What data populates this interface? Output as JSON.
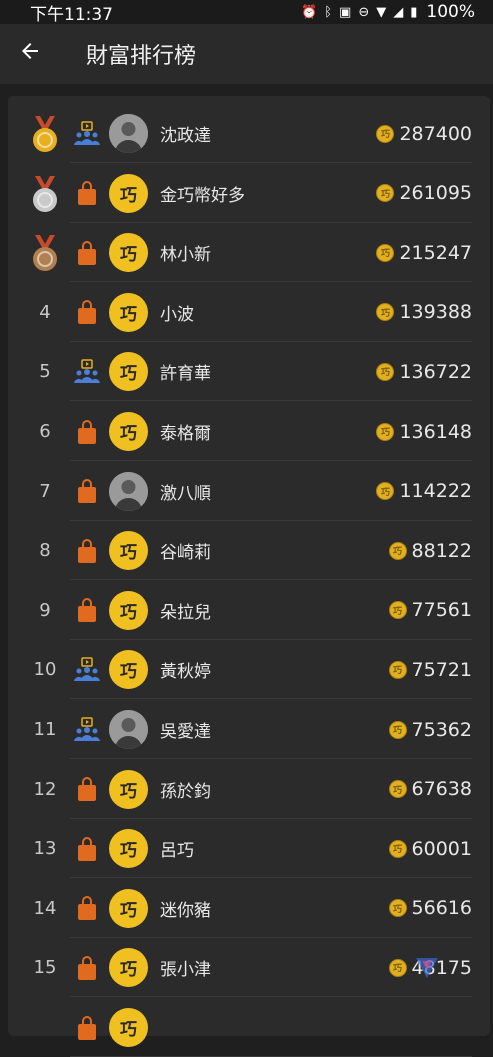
{
  "status_bar": {
    "time": "下午11:37",
    "battery_percent": "100%"
  },
  "app_bar": {
    "title": "財富排行榜"
  },
  "colors": {
    "gold_medal": "#e8b020",
    "silver_medal": "#c9c9c9",
    "bronze_medal": "#b08050",
    "ribbon": "#c84a2a",
    "coin": "#e0b020",
    "logo_bg": "#f0c020",
    "bag": "#e06a20",
    "broadcaster": "#4a7fd8"
  },
  "leaderboard": [
    {
      "rank": "1",
      "medal": "gold",
      "type": "broadcaster",
      "avatar": "photo",
      "name": "沈政達",
      "coins": "287400"
    },
    {
      "rank": "2",
      "medal": "silver",
      "type": "bag",
      "avatar": "logo",
      "name": "金巧幣好多",
      "coins": "261095"
    },
    {
      "rank": "3",
      "medal": "bronze",
      "type": "bag",
      "avatar": "logo",
      "name": "林小新",
      "coins": "215247"
    },
    {
      "rank": "4",
      "medal": "",
      "type": "bag",
      "avatar": "logo",
      "name": "小波",
      "coins": "139388"
    },
    {
      "rank": "5",
      "medal": "",
      "type": "broadcaster",
      "avatar": "logo",
      "name": "許育華",
      "coins": "136722"
    },
    {
      "rank": "6",
      "medal": "",
      "type": "bag",
      "avatar": "logo",
      "name": "泰格爾",
      "coins": "136148"
    },
    {
      "rank": "7",
      "medal": "",
      "type": "bag",
      "avatar": "photo",
      "name": "激八順",
      "coins": "114222"
    },
    {
      "rank": "8",
      "medal": "",
      "type": "bag",
      "avatar": "logo",
      "name": "谷崎莉",
      "coins": "88122"
    },
    {
      "rank": "9",
      "medal": "",
      "type": "bag",
      "avatar": "logo",
      "name": "朵拉兒",
      "coins": "77561"
    },
    {
      "rank": "10",
      "medal": "",
      "type": "broadcaster",
      "avatar": "logo",
      "name": "黃秋婷",
      "coins": "75721"
    },
    {
      "rank": "11",
      "medal": "",
      "type": "broadcaster",
      "avatar": "photo",
      "name": "吳愛達",
      "coins": "75362"
    },
    {
      "rank": "12",
      "medal": "",
      "type": "bag",
      "avatar": "logo",
      "name": "孫於鈞",
      "coins": "67638"
    },
    {
      "rank": "13",
      "medal": "",
      "type": "bag",
      "avatar": "logo",
      "name": "呂巧",
      "coins": "60001"
    },
    {
      "rank": "14",
      "medal": "",
      "type": "bag",
      "avatar": "logo",
      "name": "迷你豬",
      "coins": "56616"
    },
    {
      "rank": "15",
      "medal": "",
      "type": "bag",
      "avatar": "logo",
      "name": "張小津",
      "coins": "48175"
    }
  ],
  "logo_text": "巧"
}
